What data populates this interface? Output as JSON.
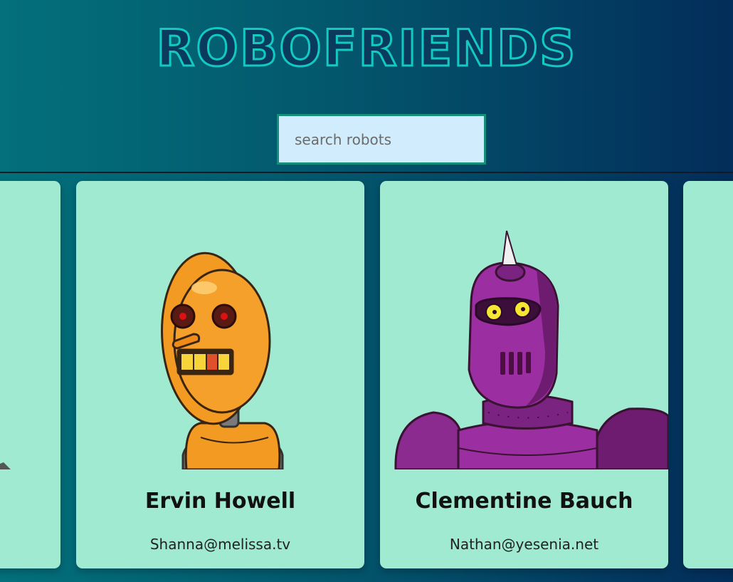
{
  "app": {
    "title": "ROBOFRIENDS"
  },
  "search": {
    "placeholder": "search robots",
    "value": ""
  },
  "robots": [
    {
      "name": "Ervin Howell",
      "email": "Shanna@melissa.tv",
      "icon": "orange-robot"
    },
    {
      "name": "Clementine Bauch",
      "email": "Nathan@yesenia.net",
      "icon": "purple-robot"
    }
  ],
  "colors": {
    "card_background": "#9fead1",
    "title_outline": "#12c9c4",
    "search_background": "#d1edfd",
    "search_border": "#138f7a"
  }
}
